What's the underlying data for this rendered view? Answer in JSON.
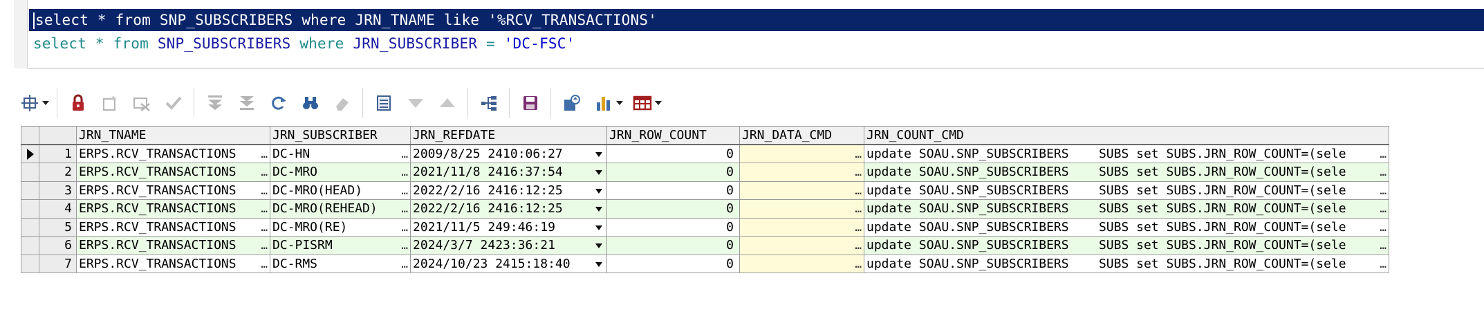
{
  "editor": {
    "line1": {
      "kw_select": "select",
      "star": "*",
      "kw_from": "from",
      "table": "SNP_SUBSCRIBERS",
      "kw_where": "where",
      "column": "JRN_TNAME",
      "kw_like": "like",
      "literal": "'%RCV_TRANSACTIONS'"
    },
    "line2": {
      "kw_select": "select",
      "star": "*",
      "kw_from": "from",
      "table": "SNP_SUBSCRIBERS",
      "kw_where": "where",
      "column": "JRN_SUBSCRIBER",
      "op": "=",
      "literal": "'DC-FSC'"
    }
  },
  "toolbar": {
    "icons": [
      "grid-settings-icon",
      "lock-icon",
      "add-record-icon",
      "delete-record-icon",
      "post-edit-icon",
      "fetch-next-icon",
      "fetch-all-icon",
      "refresh-icon",
      "find-icon",
      "clear-icon",
      "single-record-view-icon",
      "filter-icon",
      "sort-icon",
      "query-by-example-icon",
      "save-icon",
      "export-icon",
      "chart-icon",
      "table-view-icon"
    ]
  },
  "grid": {
    "columns": [
      "JRN_TNAME",
      "JRN_SUBSCRIBER",
      "JRN_REFDATE",
      "JRN_ROW_COUNT",
      "JRN_DATA_CMD",
      "JRN_COUNT_CMD"
    ],
    "ellipsis": "…",
    "rows": [
      {
        "n": "1",
        "tname": "ERPS.RCV_TRANSACTIONS",
        "subscriber": "DC-HN",
        "refdate": "2009/8/25 2410:06:27",
        "row_count": "0",
        "data_cmd": "",
        "count_cmd": "update SOAU.SNP_SUBSCRIBERS    SUBS set SUBS.JRN_ROW_COUNT=(sele"
      },
      {
        "n": "2",
        "tname": "ERPS.RCV_TRANSACTIONS",
        "subscriber": "DC-MRO",
        "refdate": "2021/11/8 2416:37:54",
        "row_count": "0",
        "data_cmd": "",
        "count_cmd": "update SOAU.SNP_SUBSCRIBERS    SUBS set SUBS.JRN_ROW_COUNT=(sele"
      },
      {
        "n": "3",
        "tname": "ERPS.RCV_TRANSACTIONS",
        "subscriber": "DC-MRO(HEAD)",
        "refdate": "2022/2/16 2416:12:25",
        "row_count": "0",
        "data_cmd": "",
        "count_cmd": "update SOAU.SNP_SUBSCRIBERS    SUBS set SUBS.JRN_ROW_COUNT=(sele"
      },
      {
        "n": "4",
        "tname": "ERPS.RCV_TRANSACTIONS",
        "subscriber": "DC-MRO(REHEAD)",
        "refdate": "2022/2/16 2416:12:25",
        "row_count": "0",
        "data_cmd": "",
        "count_cmd": "update SOAU.SNP_SUBSCRIBERS    SUBS set SUBS.JRN_ROW_COUNT=(sele"
      },
      {
        "n": "5",
        "tname": "ERPS.RCV_TRANSACTIONS",
        "subscriber": "DC-MRO(RE)",
        "refdate": "2021/11/5 249:46:19",
        "row_count": "0",
        "data_cmd": "",
        "count_cmd": "update SOAU.SNP_SUBSCRIBERS    SUBS set SUBS.JRN_ROW_COUNT=(sele"
      },
      {
        "n": "6",
        "tname": "ERPS.RCV_TRANSACTIONS",
        "subscriber": "DC-PISRM",
        "refdate": "2024/3/7 2423:36:21",
        "row_count": "0",
        "data_cmd": "",
        "count_cmd": "update SOAU.SNP_SUBSCRIBERS    SUBS set SUBS.JRN_ROW_COUNT=(sele"
      },
      {
        "n": "7",
        "tname": "ERPS.RCV_TRANSACTIONS",
        "subscriber": "DC-RMS",
        "refdate": "2024/10/23 2415:18:40",
        "row_count": "0",
        "data_cmd": "",
        "count_cmd": "update SOAU.SNP_SUBSCRIBERS    SUBS set SUBS.JRN_ROW_COUNT=(sele"
      }
    ]
  },
  "colors": {
    "selection": "#0a246a",
    "keyword": "#1f8a8a",
    "identifier": "#1a1aa6",
    "alt_row": "#eafbe6",
    "data_cmd_cell": "#fffbd9"
  }
}
